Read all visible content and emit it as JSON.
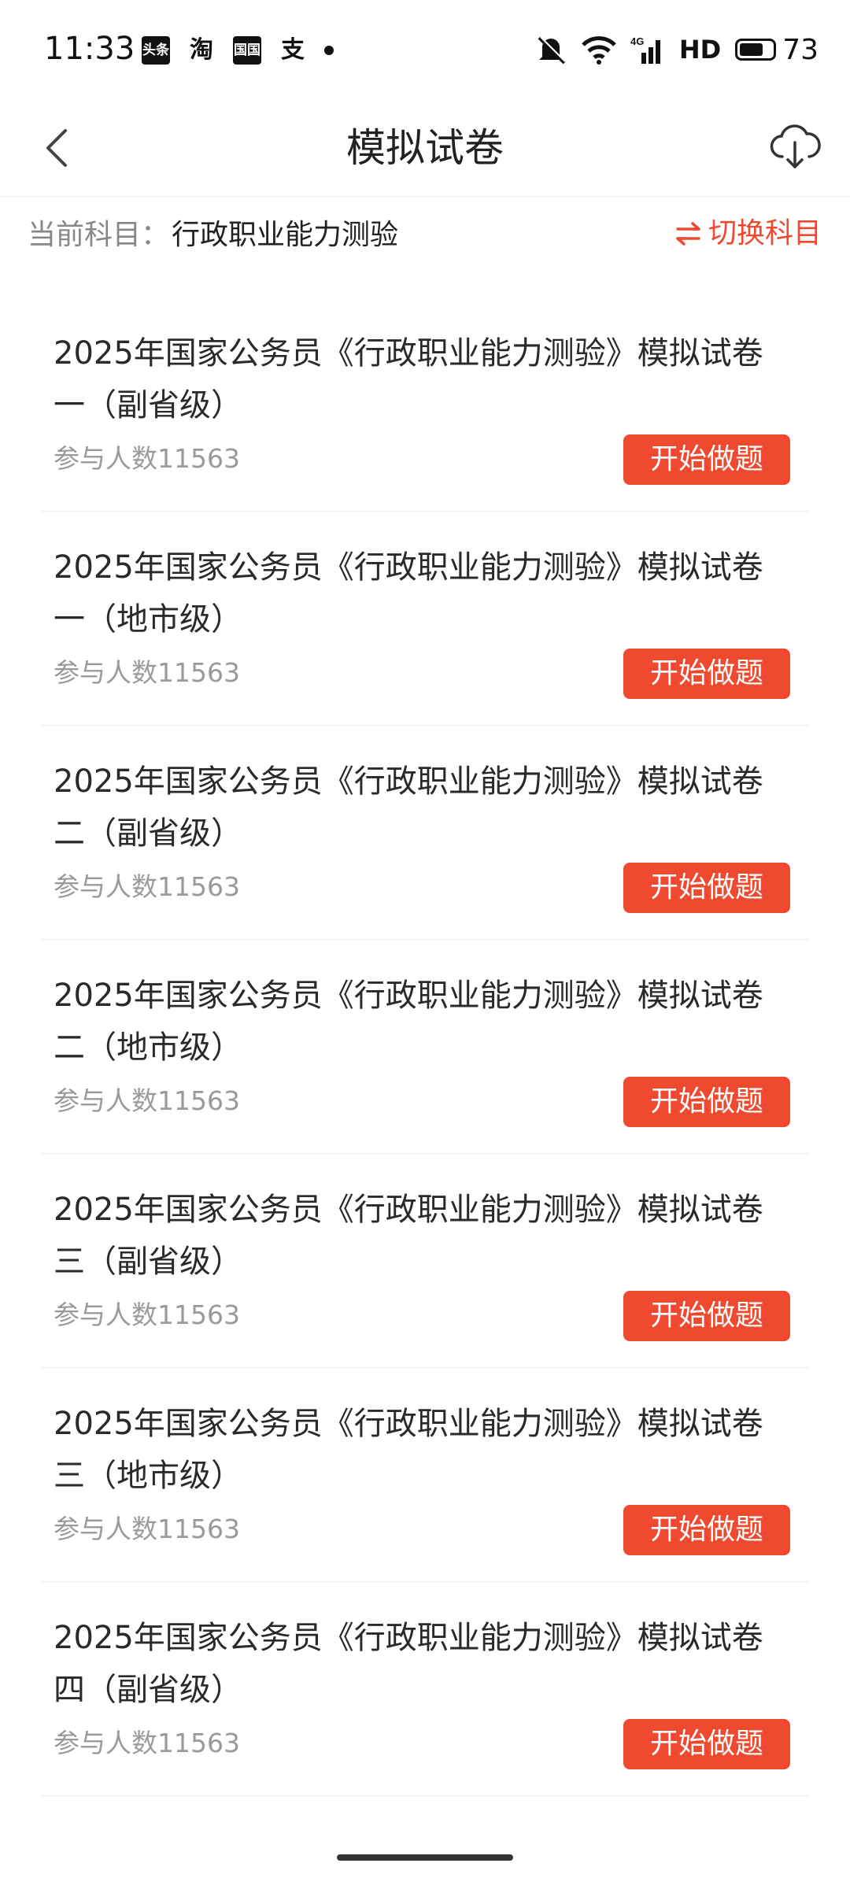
{
  "status_bar": {
    "time": "11:33",
    "app_icons": [
      {
        "label": "头条",
        "name": "toutiao-app-icon",
        "style": "dark"
      },
      {
        "label": "淘",
        "name": "taobao-app-icon",
        "style": "light"
      },
      {
        "label": "国国",
        "name": "news-app-icon",
        "style": "dark"
      },
      {
        "label": "支",
        "name": "alipay-app-icon",
        "style": "light"
      }
    ],
    "network_label": "4G",
    "hd_label": "HD",
    "battery_level": "73",
    "battery_fraction": 0.73
  },
  "nav": {
    "title": "模拟试卷"
  },
  "subject": {
    "label": "当前科目：",
    "value": "行政职业能力测验",
    "switch_label": "切换科目"
  },
  "colors": {
    "accent": "#ef4a2f"
  },
  "papers": [
    {
      "title": "2025年国家公务员《行政职业能力测验》模拟试卷一（副省级）",
      "participants": "参与人数11563",
      "button": "开始做题"
    },
    {
      "title": "2025年国家公务员《行政职业能力测验》模拟试卷一（地市级）",
      "participants": "参与人数11563",
      "button": "开始做题"
    },
    {
      "title": "2025年国家公务员《行政职业能力测验》模拟试卷二（副省级）",
      "participants": "参与人数11563",
      "button": "开始做题"
    },
    {
      "title": "2025年国家公务员《行政职业能力测验》模拟试卷二（地市级）",
      "participants": "参与人数11563",
      "button": "开始做题"
    },
    {
      "title": "2025年国家公务员《行政职业能力测验》模拟试卷三（副省级）",
      "participants": "参与人数11563",
      "button": "开始做题"
    },
    {
      "title": "2025年国家公务员《行政职业能力测验》模拟试卷三（地市级）",
      "participants": "参与人数11563",
      "button": "开始做题"
    },
    {
      "title": "2025年国家公务员《行政职业能力测验》模拟试卷四（副省级）",
      "participants": "参与人数11563",
      "button": "开始做题"
    }
  ]
}
